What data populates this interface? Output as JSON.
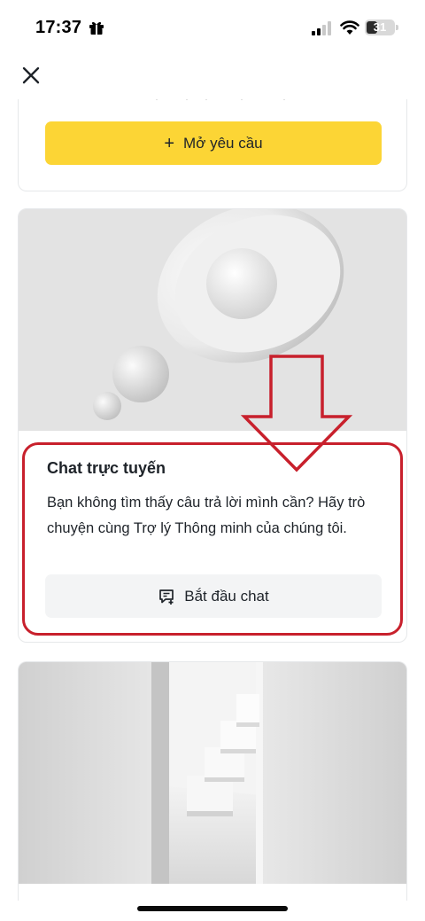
{
  "status_bar": {
    "time": "17:37",
    "battery": "31",
    "icons": [
      "gift-icon",
      "signal-icon",
      "wifi-icon",
      "battery-icon"
    ]
  },
  "nav": {
    "close_icon": "close-icon"
  },
  "request_card": {
    "button_label": "Mở yêu cầu",
    "button_icon": "+"
  },
  "chat_card": {
    "title": "Chat trực tuyến",
    "description": "Bạn không tìm thấy câu trả lời mình cần? Hãy trò chuyện cùng Trợ lý Thông minh của chúng tôi.",
    "button_label": "Bắt đầu chat",
    "button_icon": "chat-add-icon"
  },
  "colors": {
    "accent_yellow": "#fcd535",
    "annotation_red": "#c8202c",
    "text_primary": "#1e2329",
    "button_grey": "#f3f4f5"
  }
}
